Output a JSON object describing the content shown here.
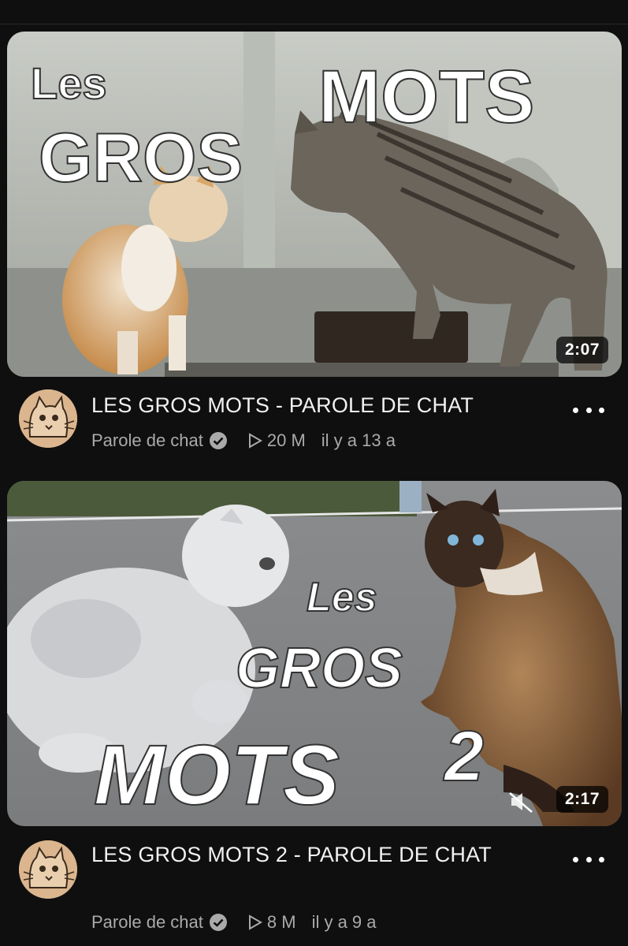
{
  "videos": [
    {
      "thumbnail_text": [
        "Les",
        "GROS",
        "MOTS"
      ],
      "duration": "2:07",
      "title": "LES GROS MOTS - PAROLE DE CHAT",
      "channel": "Parole de chat",
      "views": "20 M",
      "age": "il y a 13 a",
      "icons": [
        "verified-icon",
        "play-icon",
        "more-options-icon"
      ]
    },
    {
      "thumbnail_text": [
        "Les",
        "GROS",
        "MOTS",
        "2"
      ],
      "duration": "2:17",
      "title": "LES GROS MOTS 2 - PAROLE DE CHAT",
      "channel": "Parole de chat",
      "views": "8 M",
      "age": "il y a 9 a",
      "icons": [
        "muted-icon",
        "verified-icon",
        "play-icon",
        "more-options-icon"
      ]
    }
  ],
  "colors": {
    "background": "#0f0f0f",
    "title": "#f1f1f1",
    "meta": "#aaaaaa"
  }
}
